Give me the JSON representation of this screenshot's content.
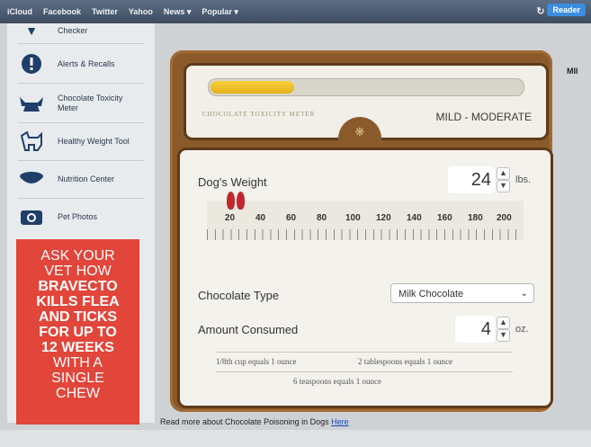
{
  "browser": {
    "bookmarks": [
      "iCloud",
      "Facebook",
      "Twitter",
      "Yahoo",
      "News ▾",
      "Popular ▾"
    ],
    "reader_label": "Reader"
  },
  "sidebar": {
    "items": [
      {
        "label": "Checker",
        "icon": "check-icon"
      },
      {
        "label": "Alerts & Recalls",
        "icon": "alert-icon"
      },
      {
        "label": "Chocolate Toxicity Meter",
        "icon": "dog-icon"
      },
      {
        "label": "Healthy Weight Tool",
        "icon": "dog-scale-icon"
      },
      {
        "label": "Nutrition Center",
        "icon": "food-bowl-icon"
      },
      {
        "label": "Pet Photos",
        "icon": "camera-icon"
      }
    ],
    "ad_lines": [
      "ASK YOUR",
      "VET HOW",
      "BRAVECTO",
      "KILLS FLEA",
      "AND TICKS",
      "FOR UP TO",
      "12 WEEKS",
      "WITH A",
      "SINGLE",
      "CHEW"
    ]
  },
  "meter": {
    "label": "CHOCOLATE TOXICITY METER",
    "level": "MILD - MODERATE",
    "fill_fraction": 0.27
  },
  "weight": {
    "label": "Dog's Weight",
    "value": "24",
    "unit": "lbs.",
    "scale": [
      "20",
      "40",
      "60",
      "80",
      "100",
      "120",
      "140",
      "160",
      "180",
      "200"
    ]
  },
  "chocolate": {
    "label": "Chocolate Type",
    "selected": "Milk Chocolate"
  },
  "amount": {
    "label": "Amount Consumed",
    "value": "4",
    "unit": "oz."
  },
  "equivalents": {
    "line1a": "1/8th cup equals 1 ounce",
    "line1b": "2 tablespoons equals 1 ounce",
    "line2": "6 teaspoons equals 1 ounce"
  },
  "footer": {
    "text": "Read more about Chocolate Poisoning in Dogs",
    "link": "Here"
  },
  "right": {
    "title": "MIl"
  }
}
